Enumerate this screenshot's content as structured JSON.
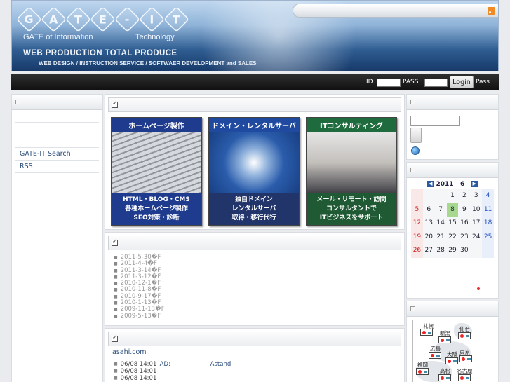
{
  "header": {
    "logo_letters": [
      "G",
      "A",
      "T",
      "E",
      "-",
      "I",
      "T"
    ],
    "logo_sub_left": "GATE of Information",
    "logo_sub_right": "Technology",
    "tagline": "WEB PRODUCTION TOTAL PRODUCE",
    "subtag": "WEB DESIGN / INSTRUCTION SERVICE / SOFTWAER DEVELOPMENT and SALES",
    "rss_icon": "rss-icon"
  },
  "login": {
    "id_label": "ID",
    "pass_label": "PASS",
    "login_button": "Login",
    "pass_link": "Pass"
  },
  "left_menu": {
    "items": [
      "GATE-IT Search",
      "RSS"
    ]
  },
  "banners": [
    {
      "title": "ホームページ製作",
      "lines": [
        "HTML・BLOG・CMS",
        "各種ホームページ製作",
        "SEO対策・診断"
      ]
    },
    {
      "title": "ドメイン・レンタルサーバ",
      "lines": [
        "独自ドメイン",
        "レンタルサーバ",
        "取得・移行代行"
      ]
    },
    {
      "title": "ITコンサルティング",
      "lines": [
        "メール・リモート・訪問",
        "コンサルタントで",
        "ITビジネスをサポート"
      ]
    }
  ],
  "updates": [
    "2011-5-30�F",
    "2011-4-4�F",
    "2011-3-14�F",
    "2011-3-12�F",
    "2010-12-1�F",
    "2010-11-8�F",
    "2010-9-17�F",
    "2010-1-13�F",
    "2009-11-13�F",
    "2009-5-13�F"
  ],
  "news": {
    "source": "asahi.com",
    "rows": [
      {
        "date": "06/08 14:01",
        "cat": "AD:",
        "title": "Astand"
      },
      {
        "date": "06/08 14:01",
        "cat": "",
        "title": ""
      },
      {
        "date": "06/08 14:01",
        "cat": "",
        "title": ""
      }
    ]
  },
  "calendar": {
    "year": "2011",
    "month": "6",
    "prev_icon": "left-arrow-icon",
    "next_icon": "right-arrow-icon",
    "today": "8",
    "weeks": [
      [
        "",
        "",
        "",
        "1",
        "2",
        "3",
        "4"
      ],
      [
        "5",
        "6",
        "7",
        "8",
        "9",
        "10",
        "11"
      ],
      [
        "12",
        "13",
        "14",
        "15",
        "16",
        "17",
        "18"
      ],
      [
        "19",
        "20",
        "21",
        "22",
        "23",
        "24",
        "25"
      ],
      [
        "26",
        "27",
        "28",
        "29",
        "30",
        "",
        ""
      ]
    ]
  },
  "weather": {
    "cities": [
      "札幌",
      "仙台",
      "新潟",
      "広島",
      "大阪",
      "東京",
      "福岡",
      "高松",
      "名古屋"
    ]
  }
}
